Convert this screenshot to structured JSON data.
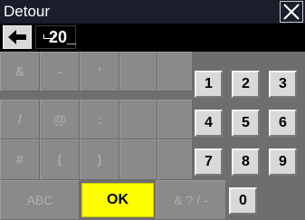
{
  "window": {
    "title": "Detour"
  },
  "input": {
    "space_key_label": "",
    "value": "20_"
  },
  "symbol_keys": {
    "r1": [
      "&",
      "-",
      "'"
    ],
    "r2": [
      "/",
      "@",
      ":"
    ],
    "r3": [
      "#",
      "(",
      ")"
    ]
  },
  "digit_keys": {
    "r1": [
      "1",
      "2",
      "3"
    ],
    "r2": [
      "4",
      "5",
      "6"
    ],
    "r3": [
      "7",
      "8",
      "9"
    ],
    "zero": "0"
  },
  "bottom_row": {
    "abc": "ABC",
    "ok": "OK",
    "symbols": "& ? / -"
  },
  "colors": {
    "ok_key": "#ffff00",
    "title_bar": "#1a1d2a",
    "input_bar": "#000000"
  },
  "icons": {
    "close": "close-icon",
    "backspace": "backspace-arrow-icon",
    "space": "space-bar-icon"
  }
}
